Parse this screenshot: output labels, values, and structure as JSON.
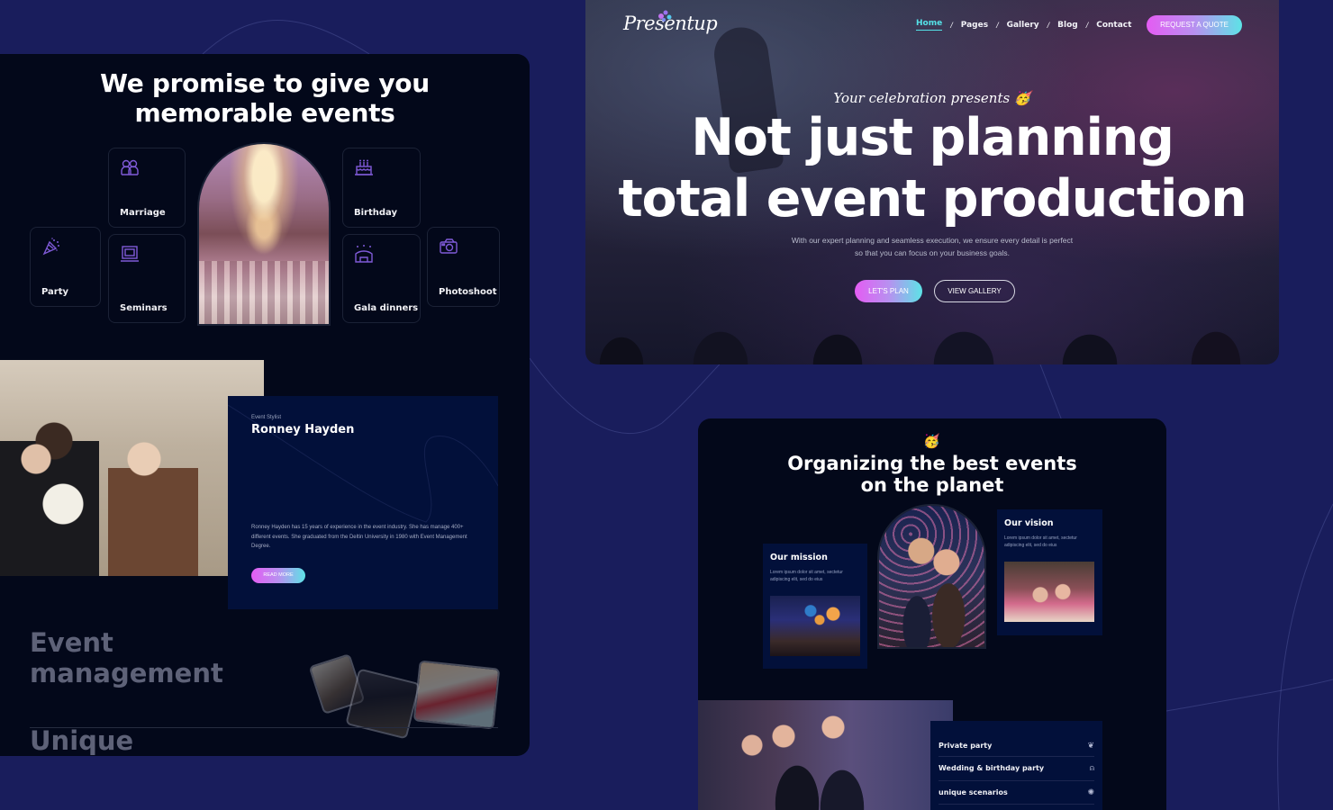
{
  "colors": {
    "page_background": "#191d5c",
    "panel_background": "#03081a",
    "card_background": "#02103a",
    "accent_cyan": "#55e2e8",
    "accent_pink": "#e45cf3",
    "icon_purple": "#7f5ad8"
  },
  "hero": {
    "logo": "Presentup",
    "nav": [
      {
        "label": "Home",
        "active": true
      },
      {
        "label": "Pages",
        "active": false
      },
      {
        "label": "Gallery",
        "active": false
      },
      {
        "label": "Blog",
        "active": false
      },
      {
        "label": "Contact",
        "active": false
      }
    ],
    "nav_separator": "/",
    "quote_button": "REQUEST A QUOTE",
    "tagline": "Your celebration presents 🥳",
    "headline_line1": "Not just planning",
    "headline_line2": "total event production",
    "subtext_line1": "With our expert planning and seamless execution, we ensure every detail is perfect",
    "subtext_line2": "so that you can focus on your business goals.",
    "primary_button": "LET'S PLAN",
    "secondary_button": "VIEW GALLERY"
  },
  "services": {
    "title_line1": "We promise to give you",
    "title_line2": "memorable events",
    "items": [
      {
        "label": "Marriage",
        "icon": "couple-icon"
      },
      {
        "label": "Party",
        "icon": "party-popper-icon"
      },
      {
        "label": "Seminars",
        "icon": "presentation-board-icon"
      },
      {
        "label": "Birthday",
        "icon": "birthday-cake-icon"
      },
      {
        "label": "Gala dinners",
        "icon": "gala-tent-icon"
      },
      {
        "label": "Photoshoot",
        "icon": "camera-icon"
      }
    ]
  },
  "stylist": {
    "role": "Event Stylist",
    "name": "Ronney Hayden",
    "bio": "Ronney Hayden has 15 years of experience in the event industry. She has manage 400+ different events. She graduated from the Deltin University in 1980 with Event Management Degree.",
    "button": "READ MORE"
  },
  "management": {
    "title_line1": "Event",
    "title_line2": "management",
    "next_title": "Unique"
  },
  "organizing": {
    "emoji": "🥳",
    "title_line1": "Organizing the best events",
    "title_line2": "on the planet",
    "mission": {
      "title": "Our mission",
      "text": "Lorem ipsum dolor sit amet, sectetur adipiscing elit, sed do eius"
    },
    "vision": {
      "title": "Our vision",
      "text": "Lorem ipsum dolor sit amet, sectetur adipiscing elit, sed do eius"
    },
    "party_types": [
      {
        "label": "Private party",
        "icon": "disco-icon",
        "glyph": "❦"
      },
      {
        "label": "Wedding & birthday party",
        "icon": "champagne-toast-icon",
        "glyph": "⍝"
      },
      {
        "label": "unique scenarios",
        "icon": "firework-icon",
        "glyph": "✺"
      }
    ]
  }
}
